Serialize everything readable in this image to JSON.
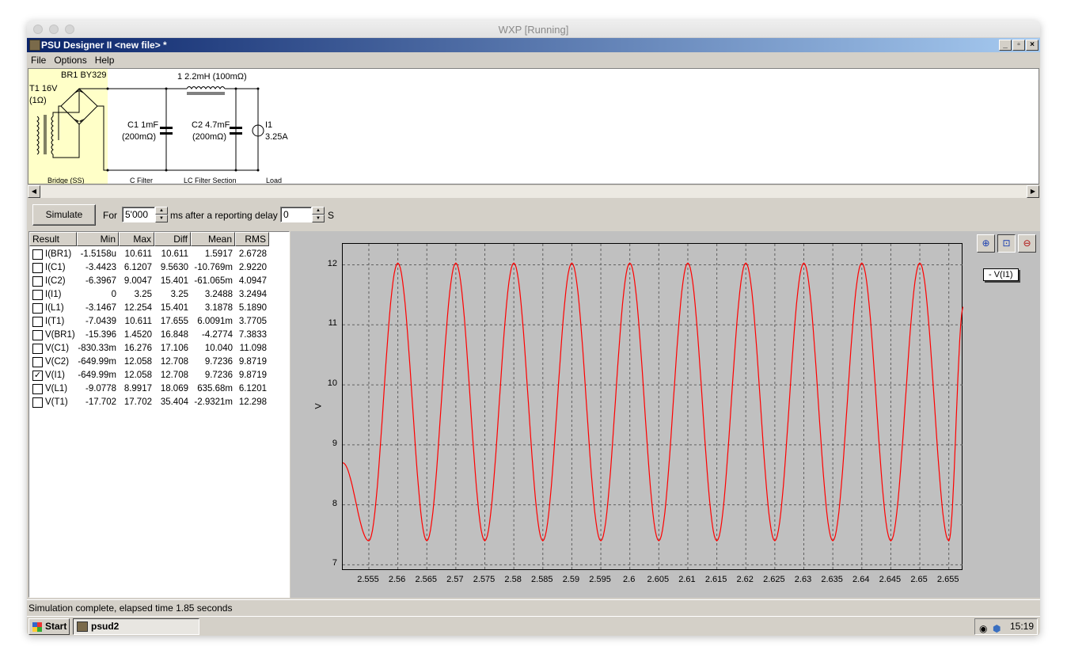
{
  "host_window": {
    "title": "WXP [Running]"
  },
  "app": {
    "title": "PSU Designer II  <new file> *"
  },
  "menu": [
    "File",
    "Options",
    "Help"
  ],
  "schematic": {
    "transformer": {
      "name": "T1 16V",
      "resistance": "(1Ω)"
    },
    "bridge": {
      "name": "BR1 BY329"
    },
    "c1": {
      "name": "C1 1mF",
      "esr": "(200mΩ)"
    },
    "inductor": {
      "name": "1 2.2mH (100mΩ)"
    },
    "c2": {
      "name": "C2 4.7mF",
      "esr": "(200mΩ)"
    },
    "load": {
      "name": "I1",
      "value": "3.25A"
    },
    "sections": [
      "Bridge (SS)",
      "C Filter",
      "LC Filter Section",
      "Load"
    ]
  },
  "simulate": {
    "button": "Simulate",
    "for_label": "For",
    "duration": "5'000",
    "ms_label": "ms",
    "delay_label": "after a reporting delay of",
    "delay": "0",
    "s_label": "S"
  },
  "results": {
    "headers": [
      "Result",
      "Min",
      "Max",
      "Diff",
      "Mean",
      "RMS"
    ],
    "rows": [
      {
        "name": "I(BR1)",
        "min": "-1.5158u",
        "max": "10.611",
        "diff": "10.611",
        "mean": "1.5917",
        "rms": "2.6728",
        "checked": false
      },
      {
        "name": "I(C1)",
        "min": "-3.4423",
        "max": "6.1207",
        "diff": "9.5630",
        "mean": "-10.769m",
        "rms": "2.9220",
        "checked": false
      },
      {
        "name": "I(C2)",
        "min": "-6.3967",
        "max": "9.0047",
        "diff": "15.401",
        "mean": "-61.065m",
        "rms": "4.0947",
        "checked": false
      },
      {
        "name": "I(I1)",
        "min": "0",
        "max": "3.25",
        "diff": "3.25",
        "mean": "3.2488",
        "rms": "3.2494",
        "checked": false
      },
      {
        "name": "I(L1)",
        "min": "-3.1467",
        "max": "12.254",
        "diff": "15.401",
        "mean": "3.1878",
        "rms": "5.1890",
        "checked": false
      },
      {
        "name": "I(T1)",
        "min": "-7.0439",
        "max": "10.611",
        "diff": "17.655",
        "mean": "6.0091m",
        "rms": "3.7705",
        "checked": false
      },
      {
        "name": "V(BR1)",
        "min": "-15.396",
        "max": "1.4520",
        "diff": "16.848",
        "mean": "-4.2774",
        "rms": "7.3833",
        "checked": false
      },
      {
        "name": "V(C1)",
        "min": "-830.33m",
        "max": "16.276",
        "diff": "17.106",
        "mean": "10.040",
        "rms": "11.098",
        "checked": false
      },
      {
        "name": "V(C2)",
        "min": "-649.99m",
        "max": "12.058",
        "diff": "12.708",
        "mean": "9.7236",
        "rms": "9.8719",
        "checked": false
      },
      {
        "name": "V(I1)",
        "min": "-649.99m",
        "max": "12.058",
        "diff": "12.708",
        "mean": "9.7236",
        "rms": "9.8719",
        "checked": true
      },
      {
        "name": "V(L1)",
        "min": "-9.0778",
        "max": "8.9917",
        "diff": "18.069",
        "mean": "635.68m",
        "rms": "6.1201",
        "checked": false
      },
      {
        "name": "V(T1)",
        "min": "-17.702",
        "max": "17.702",
        "diff": "35.404",
        "mean": "-2.9321m",
        "rms": "12.298",
        "checked": false
      }
    ]
  },
  "plot": {
    "legend": "- V(I1)",
    "toolbar_icons": [
      "zoom-in-icon",
      "zoom-window-icon",
      "zoom-out-icon"
    ]
  },
  "chart_data": {
    "type": "line",
    "ylabel": "V",
    "xlabel": "",
    "xlim": [
      2.5505,
      2.6575
    ],
    "ylim": [
      6.9,
      12.35
    ],
    "x_ticks": [
      "2.555",
      "2.56",
      "2.565",
      "2.57",
      "2.575",
      "2.58",
      "2.585",
      "2.59",
      "2.595",
      "2.6",
      "2.605",
      "2.61",
      "2.615",
      "2.62",
      "2.625",
      "2.63",
      "2.635",
      "2.64",
      "2.645",
      "2.65",
      "2.655"
    ],
    "y_ticks": [
      "7",
      "8",
      "9",
      "10",
      "11",
      "12"
    ],
    "grid": true,
    "series": [
      {
        "name": "V(I1)",
        "color": "#ff0000",
        "x": [
          2.5505,
          2.555,
          2.56,
          2.565,
          2.57,
          2.575,
          2.58,
          2.585,
          2.59,
          2.595,
          2.6,
          2.605,
          2.61,
          2.615,
          2.62,
          2.625,
          2.63,
          2.635,
          2.64,
          2.645,
          2.65,
          2.655,
          2.6575
        ],
        "y": [
          8.7,
          7.4,
          12.03,
          7.4,
          12.03,
          7.4,
          12.03,
          7.4,
          12.03,
          7.4,
          12.03,
          7.4,
          12.03,
          7.4,
          12.03,
          7.4,
          12.03,
          7.4,
          12.03,
          7.4,
          12.03,
          7.4,
          11.3
        ]
      }
    ]
  },
  "status": "Simulation complete, elapsed time 1.85 seconds",
  "taskbar": {
    "start": "Start",
    "task": "psud2",
    "clock": "15:19"
  }
}
